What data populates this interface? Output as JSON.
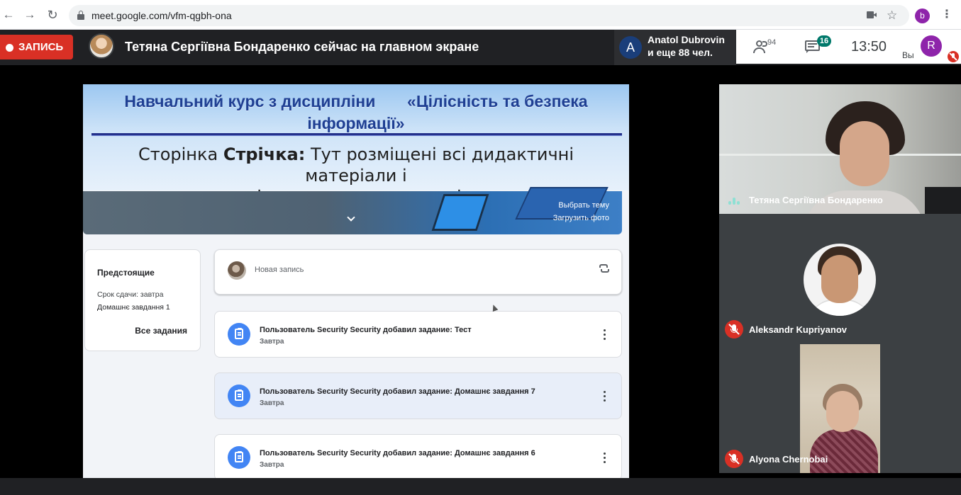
{
  "browser": {
    "url": "meet.google.com/vfm-qgbh-ona",
    "profile_initial": "b"
  },
  "meet": {
    "recording_label": "ЗАПИСЬ",
    "presenting_text": "Тетяна Сергіївна Бондаренко сейчас на главном экране",
    "active_speaker": {
      "initial": "A",
      "name": "Anatol Dubrovin",
      "others": "и еще 88 чел."
    },
    "people_count": "94",
    "chat_count": "16",
    "time": "13:50",
    "self": {
      "initial": "R",
      "label": "Вы"
    }
  },
  "slide": {
    "title_line1": "Навчальний курс з дисципліни       «Цілісність та безпека",
    "title_line2": "інформації»",
    "subtitle_prefix": "Сторінка ",
    "subtitle_bold": "Стрічка:",
    "subtitle_rest": " Тут розміщені всі дидактичні матеріали і",
    "subtitle_line2": "останні новини по активності курсу",
    "banner_link1": "Выбрать тему",
    "banner_link2": "Загрузить фото",
    "upcoming": {
      "title": "Предстоящие",
      "line1": "Срок сдачи: завтра",
      "line2": "Домашнє завдання 1",
      "view_all": "Все задания"
    },
    "new_post_placeholder": "Новая запись",
    "tasks": [
      {
        "title": "Пользователь Security Security добавил задание: Тест",
        "due": "Завтра"
      },
      {
        "title": "Пользователь Security Security добавил задание: Домашнє завдання 7",
        "due": "Завтра"
      },
      {
        "title": "Пользователь Security Security добавил задание: Домашнє завдання 6",
        "due": "Завтра"
      }
    ]
  },
  "participants": [
    {
      "name": "Тетяна Сергіївна Бондаренко",
      "state": "speaking"
    },
    {
      "name": "Aleksandr Kupriyanov",
      "state": "muted"
    },
    {
      "name": "Alyona Chernobai",
      "state": "muted"
    }
  ]
}
